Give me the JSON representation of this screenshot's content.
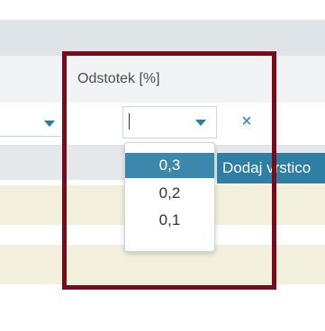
{
  "column": {
    "label": "Odstotek [%]"
  },
  "cell_select": {
    "value": ""
  },
  "dropdown": {
    "options": [
      "0,3",
      "0,2",
      "0,1"
    ],
    "selected": "0,3"
  },
  "clear_icon": "×",
  "add_row_button": {
    "label": "Dodaj vrstico"
  },
  "colors": {
    "accent": "#2f78a4",
    "selected_option": "#3c88ad",
    "highlight_frame": "#7a0a1c",
    "row_background": "#f2efdc"
  }
}
